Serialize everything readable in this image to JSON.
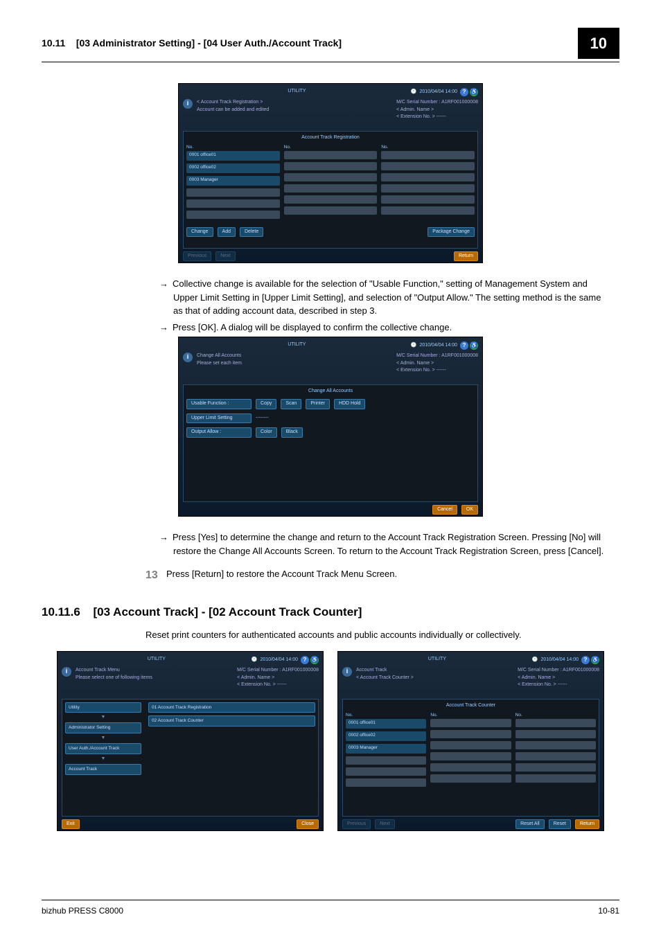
{
  "header": {
    "section_number": "10.11",
    "section_title": "[03 Administrator Setting] - [04 User Auth./Account Track]",
    "chapter": "10"
  },
  "shared": {
    "utility_label": "UTILITY",
    "datetime": "2010/04/04 14:00",
    "serial_label": "M/C Serial Number :",
    "serial_value": "A1RF001000008",
    "admin_name_label": "< Admin.  Name >",
    "extension_label": "< Extension No. >",
    "extension_value": "------",
    "badge_q": "?",
    "badge_p": "♿"
  },
  "panel1": {
    "info_line1": "< Account Track Registration >",
    "info_line2": "Account can be added and edited",
    "inner_title": "Account Track Registration",
    "col_label": "No.",
    "accounts": [
      "0001 office01",
      "0002 office02",
      "0003 Manager"
    ],
    "btn_change": "Change",
    "btn_add": "Add",
    "btn_delete": "Delete",
    "btn_package": "Package Change",
    "btn_return": "Return",
    "nav_prev": "Previous",
    "nav_next": "Next"
  },
  "para1_line1": "Collective change is available for the selection of \"Usable Function,\" setting of Management System and Upper Limit Setting in [Upper Limit Setting], and selection of \"Output Allow.\" The setting method is the same as that of adding account data, described in step 3.",
  "para1_line2": "Press [OK]. A dialog will be displayed to confirm the collective change.",
  "panel2": {
    "info_line1": "Change All Accounts",
    "info_line2": "Please set each item",
    "inner_title": "Change All Accounts",
    "row1_label": "Usable Function :",
    "row1_btns": [
      "Copy",
      "Scan",
      "Printer",
      "HDD Hold"
    ],
    "row2_label": "Upper Limit Setting",
    "row2_value": "--------",
    "row3_label": "Output Allow :",
    "row3_btns": [
      "Color",
      "Black"
    ],
    "btn_cancel": "Cancel",
    "btn_ok": "OK"
  },
  "para2": "Press [Yes] to determine the change and return to the Account Track Registration Screen. Pressing [No] will restore the Change All Accounts Screen. To return to the Account Track Registration Screen, press [Cancel].",
  "step13": {
    "num": "13",
    "text": "Press [Return] to restore the Account Track Menu Screen."
  },
  "section2": {
    "num": "10.11.6",
    "title": "[03 Account Track] - [02 Account Track Counter]",
    "desc": "Reset print counters for authenticated accounts and public accounts individually or collectively."
  },
  "panel3": {
    "info_line1": "Account Track Menu",
    "info_line2": "Please select one of following items",
    "nav": [
      "Utility",
      "Administrator Setting",
      "User Auth./Account Track",
      "Account Track"
    ],
    "menu": [
      "01 Account Track Registration",
      "02 Account Track Counter"
    ],
    "btn_exit": "Exit",
    "btn_close": "Close"
  },
  "panel4": {
    "info_line1": "Account Track",
    "info_line2": "< Account Track Counter >",
    "inner_title": "Account Track Counter",
    "col_label": "No.",
    "accounts": [
      "0001 office01",
      "0002 office02",
      "0003 Manager"
    ],
    "btn_reset_all": "Reset All",
    "btn_reset": "Reset",
    "btn_return": "Return",
    "nav_prev": "Previous",
    "nav_next": "Next"
  },
  "footer": {
    "product": "bizhub PRESS C8000",
    "page": "10-81"
  }
}
